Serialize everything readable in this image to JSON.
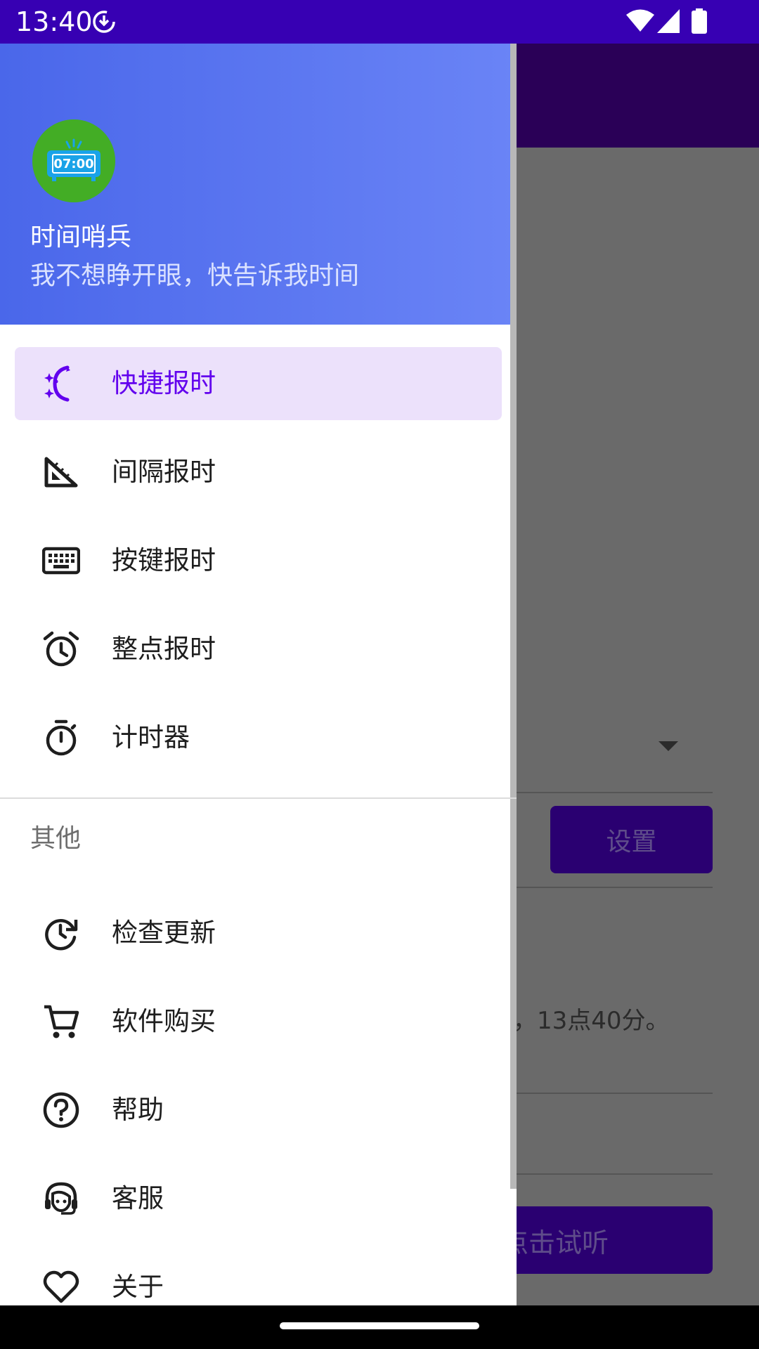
{
  "status_bar": {
    "time": "13:40",
    "icons": [
      "sync-download-icon",
      "wifi-icon",
      "signal-icon",
      "battery-icon"
    ]
  },
  "background": {
    "set_button": "设置",
    "time_text": "，13点40分。",
    "listen_button": "点击试听"
  },
  "drawer": {
    "header": {
      "logo_time": "07:00",
      "app_name": "时间哨兵",
      "tagline": "我不想睁开眼，快告诉我时间"
    },
    "main_items": [
      {
        "label": "快捷报时",
        "icon": "sparkle-moon-icon",
        "active": true
      },
      {
        "label": "间隔报时",
        "icon": "set-square-icon"
      },
      {
        "label": "按键报时",
        "icon": "keyboard-icon"
      },
      {
        "label": "整点报时",
        "icon": "alarm-clock-icon"
      },
      {
        "label": "计时器",
        "icon": "timer-icon"
      }
    ],
    "section_title": "其他",
    "other_items": [
      {
        "label": "检查更新",
        "icon": "update-icon"
      },
      {
        "label": "软件购买",
        "icon": "cart-icon"
      },
      {
        "label": "帮助",
        "icon": "help-icon"
      },
      {
        "label": "客服",
        "icon": "headset-icon"
      },
      {
        "label": "关于",
        "icon": "heart-icon"
      }
    ]
  },
  "colors": {
    "status_bar": "#3700b3",
    "header_start": "#4a67ea",
    "header_end": "#6a84f6",
    "active_bg": "#ece1fb",
    "active_text": "#6200ee",
    "logo_green": "#43ad25",
    "logo_screen": "#1aa3e8"
  }
}
